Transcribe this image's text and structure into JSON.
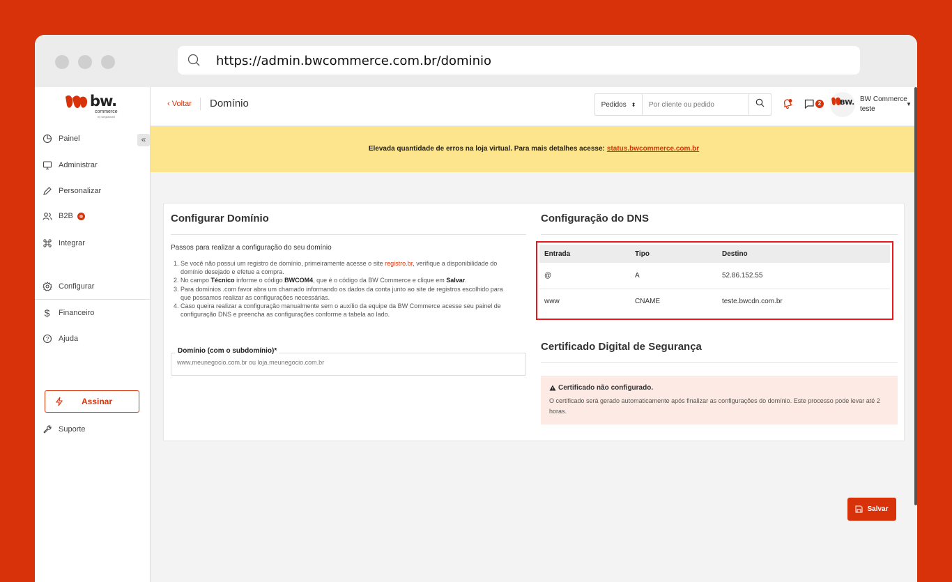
{
  "browser": {
    "url": "https://admin.bwcommerce.com.br/dominio"
  },
  "logo": {
    "text": "bw.",
    "sub": "commerce",
    "by": "by wegusmart"
  },
  "sidebar": {
    "items": [
      {
        "label": "Painel",
        "icon": "pie-chart-icon"
      },
      {
        "label": "Administrar",
        "icon": "monitor-icon"
      },
      {
        "label": "Personalizar",
        "icon": "pen-icon"
      },
      {
        "label": "B2B",
        "icon": "users-icon"
      },
      {
        "label": "Integrar",
        "icon": "command-icon"
      },
      {
        "label": "Configurar",
        "icon": "gear-icon"
      },
      {
        "label": "Financeiro",
        "icon": "dollar-icon"
      },
      {
        "label": "Ajuda",
        "icon": "help-icon"
      }
    ],
    "assinar_label": "Assinar",
    "suporte_label": "Suporte",
    "collapse_label": "«"
  },
  "topbar": {
    "back_label": "‹ Voltar",
    "page_title": "Domínio",
    "search_type": "Pedidos",
    "search_placeholder": "Por cliente ou pedido",
    "chat_count": "2",
    "user_name": "BW Commerce",
    "store_name": "teste",
    "avatar_text": "BW."
  },
  "alert": {
    "text": "Elevada quantidade de erros na loja virtual. Para mais detalhes acesse:",
    "link": "status.bwcommerce.com.br"
  },
  "configurar": {
    "title": "Configurar Domínio",
    "steps_title": "Passos para realizar a configuração do seu domínio",
    "step1_a": "Se você não possui um registro de domínio, primeiramente acesse o site",
    "step1_link": "registro.br",
    "step1_b": ", verifique a disponibilidade do",
    "step1_c": "domínio desejado e efetue a compra.",
    "step2_a": "No campo",
    "step2_b1": "Técnico",
    "step2_c": "informe o código",
    "step2_b2": "BWCOM4",
    "step2_d": ", que é o código da BW Commerce e clique em",
    "step2_b3": "Salvar",
    "step2_e": ".",
    "step3_a": "Para domínios .com favor abra um chamado informando os dados da conta junto ao site de registros escolhido para",
    "step3_b": "que possamos realizar as configurações necessárias.",
    "step4_a": "Caso queira realizar a configuração manualmente sem o auxílio da equipe da BW Commerce acesse seu painel de",
    "step4_b": "configuração DNS e preencha as configurações conforme a tabela ao lado.",
    "field_label": "Domínio (com o subdomínio)*",
    "field_placeholder": "www.meunegocio.com.br ou loja.meunegocio.com.br"
  },
  "dns": {
    "title": "Configuração do DNS",
    "headers": [
      "Entrada",
      "Tipo",
      "Destino"
    ],
    "rows": [
      [
        "@",
        "A",
        "52.86.152.55"
      ],
      [
        "www",
        "CNAME",
        "teste.bwcdn.com.br"
      ]
    ]
  },
  "certificado": {
    "title": "Certificado Digital de Segurança",
    "warn_title": "Certificado não configurado.",
    "warn_text": "O certificado será gerado automaticamente após finalizar as configurações do domínio. Este processo pode levar até 2 horas."
  },
  "save_label": "Salvar",
  "colors": {
    "brand": "#d8320a",
    "alert_bg": "#fde58e",
    "highlight": "#e8171c"
  }
}
